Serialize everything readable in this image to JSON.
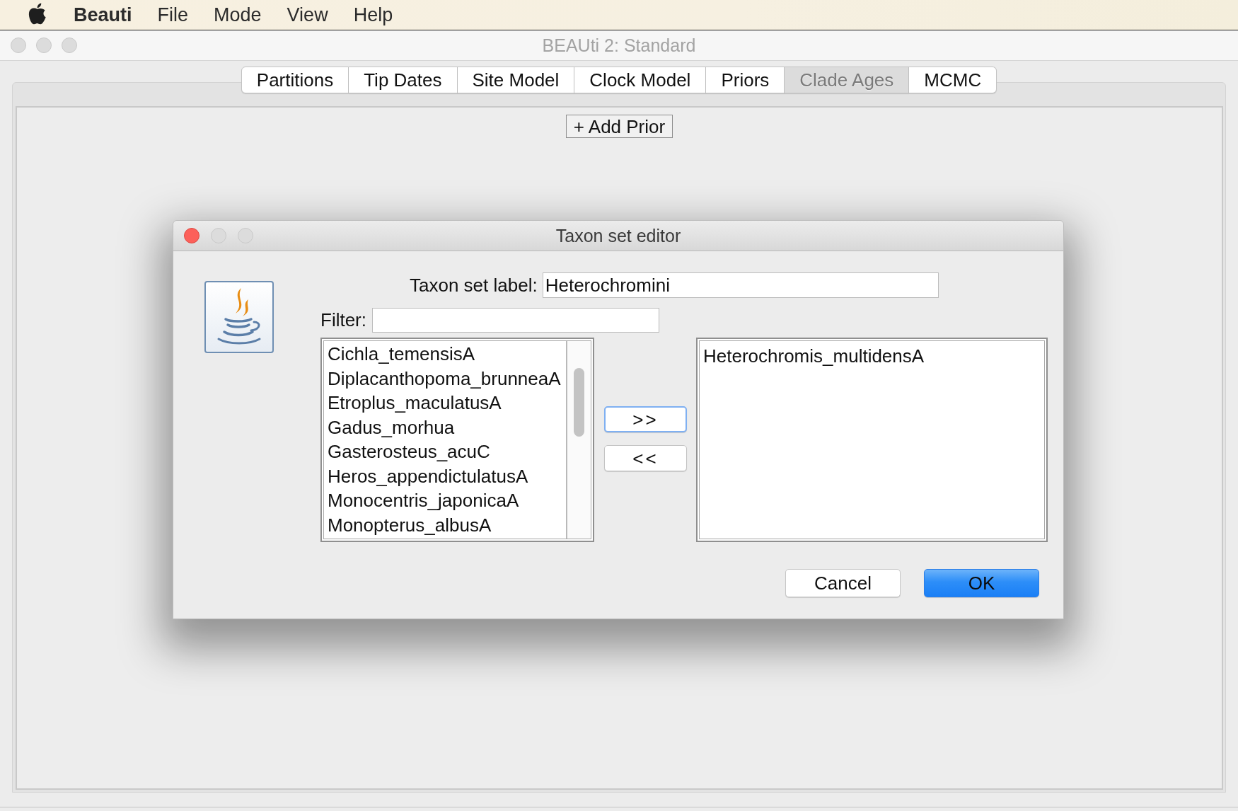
{
  "menu_bar": {
    "app_name": "Beauti",
    "items": [
      "File",
      "Mode",
      "View",
      "Help"
    ]
  },
  "window": {
    "title": "BEAUti 2: Standard",
    "active": false
  },
  "tabs": [
    {
      "label": "Partitions",
      "selected": false
    },
    {
      "label": "Tip Dates",
      "selected": false
    },
    {
      "label": "Site Model",
      "selected": false
    },
    {
      "label": "Clock Model",
      "selected": false
    },
    {
      "label": "Priors",
      "selected": false
    },
    {
      "label": "Clade Ages",
      "selected": true
    },
    {
      "label": "MCMC",
      "selected": false
    }
  ],
  "add_prior_button": "+ Add Prior",
  "dialog": {
    "title": "Taxon set editor",
    "active": true,
    "taxon_set_label": {
      "label": "Taxon set label:",
      "value": "Heterochromini"
    },
    "filter": {
      "label": "Filter:"
    },
    "available_taxa": [
      "Cichla_temensisA",
      "Diplacanthopoma_brunneaA",
      "Etroplus_maculatusA",
      "Gadus_morhua",
      "Gasterosteus_acuC",
      "Heros_appendictulatusA",
      "Monocentris_japonicaA",
      "Monopterus_albusA"
    ],
    "transfer_buttons": [
      {
        "label": ">>",
        "focused": true
      },
      {
        "label": "<<",
        "focused": false
      }
    ],
    "selected_taxa": [
      "Heterochromis_multidensA"
    ],
    "buttons": [
      {
        "label": "Cancel",
        "default": false
      },
      {
        "label": "OK",
        "default": true
      }
    ]
  }
}
